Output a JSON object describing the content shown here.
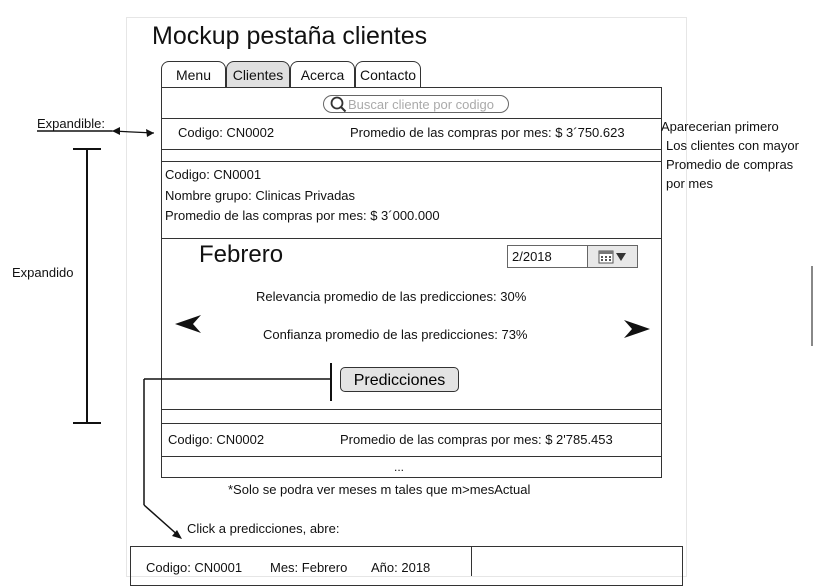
{
  "page": {
    "title": "Mockup pestaña clientes"
  },
  "tabs": [
    {
      "label": "Menu",
      "active": false
    },
    {
      "label": "Clientes",
      "active": true
    },
    {
      "label": "Acerca",
      "active": false
    },
    {
      "label": "Contacto",
      "active": false
    }
  ],
  "search": {
    "placeholder": "Buscar cliente por codigo",
    "icon": "search-icon"
  },
  "collapsed_client": {
    "code": "Codigo: CN0002",
    "average": "Promedio de las compras por mes: $ 3´750.623"
  },
  "expanded_client": {
    "code": "Codigo: CN0001",
    "group": "Nombre grupo: Clinicas Privadas",
    "average": "Promedio de las compras por mes: $ 3´000.000",
    "month": "Febrero",
    "date_value": "2/2018",
    "relevance": "Relevancia promedio de las predicciones: 30%",
    "confidence": "Confianza promedio de las predicciones: 73%",
    "predictions_button": "Predicciones",
    "prev_icon": "arrow-left-icon",
    "next_icon": "arrow-right-icon"
  },
  "last_client": {
    "code": "Codigo: CN0002",
    "average": "Promedio de las compras por mes: $ 2'785.453"
  },
  "more": "...",
  "note": "*Solo se podra ver meses m tales que m>mesActual",
  "click_note": "Click a predicciones, abre:",
  "annotations": {
    "expandible": "Expandible:",
    "expandido": "Expandido",
    "order_note": [
      "Aparecerian primero",
      "Los clientes con mayor",
      "Promedio de compras",
      "por mes"
    ]
  },
  "detail_preview": {
    "code": "Codigo: CN0001",
    "month": "Mes: Febrero",
    "year": "Año: 2018"
  }
}
